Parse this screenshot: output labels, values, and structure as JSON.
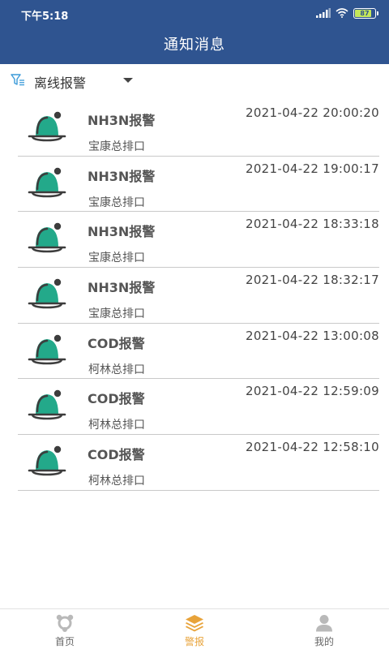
{
  "status_bar": {
    "time": "下午5:18",
    "battery": "87",
    "battery_fraction": 0.87
  },
  "header": {
    "title": "通知消息"
  },
  "filter": {
    "icon": "filter-icon",
    "selected": "离线报警"
  },
  "alerts": [
    {
      "title": "NH3N报警",
      "location": "宝康总排口",
      "time": "2021-04-22 20:00:20"
    },
    {
      "title": "NH3N报警",
      "location": "宝康总排口",
      "time": "2021-04-22 19:00:17"
    },
    {
      "title": "NH3N报警",
      "location": "宝康总排口",
      "time": "2021-04-22 18:33:18"
    },
    {
      "title": "NH3N报警",
      "location": "宝康总排口",
      "time": "2021-04-22 18:32:17"
    },
    {
      "title": "COD报警",
      "location": "柯林总排口",
      "time": "2021-04-22 13:00:08"
    },
    {
      "title": "COD报警",
      "location": "柯林总排口",
      "time": "2021-04-22 12:59:09"
    },
    {
      "title": "COD报警",
      "location": "柯林总排口",
      "time": "2021-04-22 12:58:10"
    }
  ],
  "tabbar": {
    "tabs": [
      {
        "label": "首页",
        "icon": "home-icon",
        "active": false
      },
      {
        "label": "警报",
        "icon": "layers-icon",
        "active": true
      },
      {
        "label": "我的",
        "icon": "user-icon",
        "active": false
      }
    ]
  },
  "colors": {
    "header_bg": "#2f5490",
    "bell_green": "#23a98a",
    "active_tab": "#e8a33a"
  }
}
